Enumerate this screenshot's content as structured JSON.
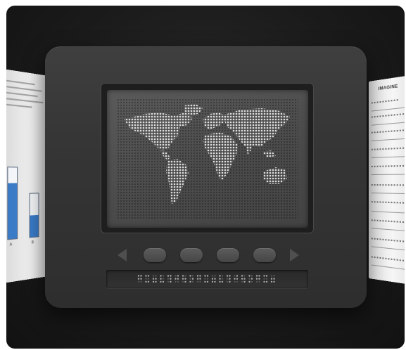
{
  "side_documents": {
    "left": {
      "bar_values": [
        0.78,
        0.5
      ],
      "tick_labels": [
        "A",
        "B"
      ]
    },
    "right": {
      "heading": "IMAGINE"
    }
  },
  "device": {
    "screen": {
      "content_icon": "world-map-icon"
    },
    "controls": [
      "previous-arrow",
      "button-1",
      "button-2",
      "button-3",
      "button-4",
      "next-arrow"
    ],
    "braille_cells": 19
  },
  "colors": {
    "background": "#1b1b1b",
    "device_body": "#363636",
    "screen": "#4c4c4c",
    "map_dots": "#d8d8d8",
    "chart_bar": "#3a7bc8"
  }
}
